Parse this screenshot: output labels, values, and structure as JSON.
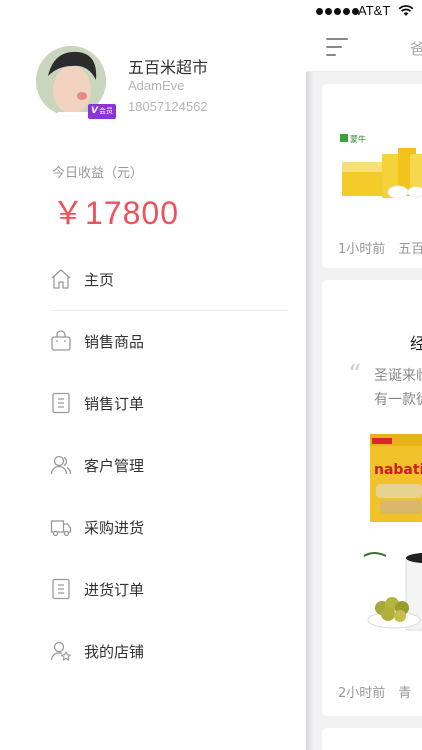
{
  "status_bar": {
    "carrier": "AT&T"
  },
  "nav": {
    "title_partial": "爸"
  },
  "profile": {
    "store_name": "五百米超市",
    "user_name": "AdamEve",
    "phone": "18057124562",
    "vip_badge": {
      "letter": "V",
      "text": "会员",
      "color": "#8b35d6"
    }
  },
  "income": {
    "label": "今日收益（元）",
    "value": "￥17800",
    "color": "#f0505a"
  },
  "menu": {
    "items": [
      {
        "label": "主页",
        "icon": "home-icon"
      },
      {
        "label": "销售商品",
        "icon": "shopping-bag-icon"
      },
      {
        "label": "销售订单",
        "icon": "order-list-icon"
      },
      {
        "label": "客户管理",
        "icon": "customers-icon"
      },
      {
        "label": "采购进货",
        "icon": "truck-icon"
      },
      {
        "label": "进货订单",
        "icon": "purchase-order-icon"
      },
      {
        "label": "我的店铺",
        "icon": "my-store-icon"
      }
    ]
  },
  "feed": {
    "card1": {
      "brand_logo": "蒙牛",
      "meta": "1小时前　五百"
    },
    "card2": {
      "title": "经",
      "excerpt_line1": "圣诞来临",
      "excerpt_line2": "有一款徒",
      "meta": "2小时前　青",
      "product_brand": "nabati"
    }
  }
}
